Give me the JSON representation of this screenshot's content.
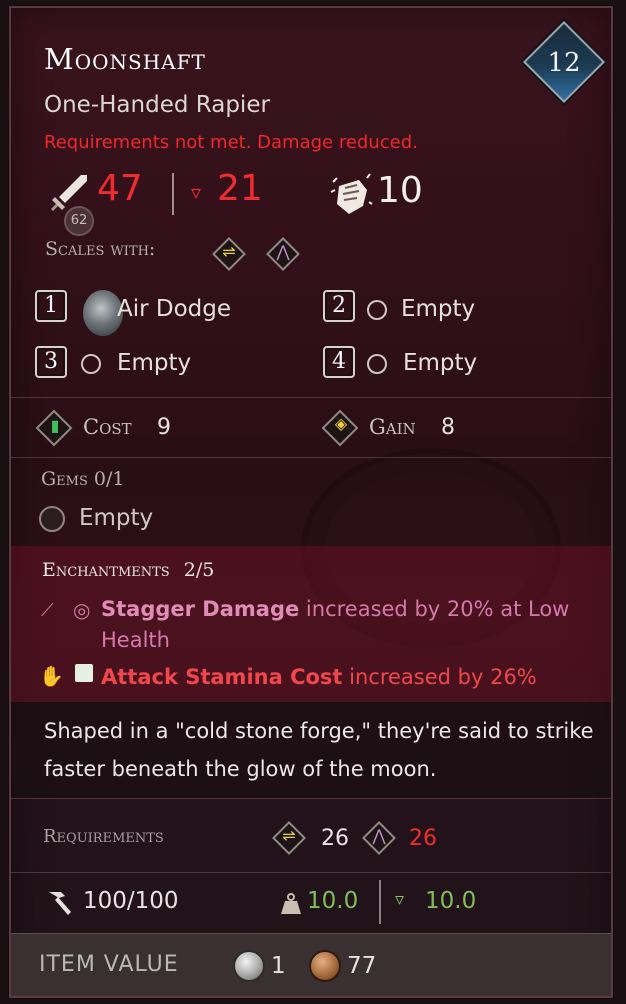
{
  "item": {
    "name": "Moonshaft",
    "type": "One-Handed Rapier",
    "warning": "Requirements not met. Damage reduced.",
    "level": "12"
  },
  "stats": {
    "attack": "47",
    "attack_sub": "62",
    "crit": "21",
    "stagger": "10",
    "colors": {
      "reduced": "#f02c2e",
      "good": "#7fbf56"
    }
  },
  "scales": {
    "label": "Scales with:",
    "icons": [
      "dexterity-icon",
      "faith-icon"
    ]
  },
  "sockets": [
    {
      "number": "1",
      "label": "Air Dodge"
    },
    {
      "number": "2",
      "label": "Empty"
    },
    {
      "number": "3",
      "label": "Empty"
    },
    {
      "number": "4",
      "label": "Empty"
    }
  ],
  "cost": {
    "label": "Cost",
    "value": "9"
  },
  "gain": {
    "label": "Gain",
    "value": "8"
  },
  "gems": {
    "label": "Gems 0/1",
    "slot_label": "Empty"
  },
  "enchantments": {
    "label": "Enchantments",
    "count": "2/5",
    "items": [
      {
        "name": "Stagger Damage",
        "text": " increased by 20% at Low Health"
      },
      {
        "name": "Attack Stamina Cost",
        "text": " increased by 26%"
      }
    ]
  },
  "description": "Shaped in a \"cold stone forge,\" they're said to strike faster beneath the glow of the moon.",
  "requirements": {
    "label": "Requirements",
    "dexterity": "26",
    "faith": "26"
  },
  "durability": "100/100",
  "weight": {
    "value": "10.0",
    "threshold": "10.0"
  },
  "item_value": {
    "label": "ITEM VALUE",
    "silver": "1",
    "bronze": "77"
  }
}
